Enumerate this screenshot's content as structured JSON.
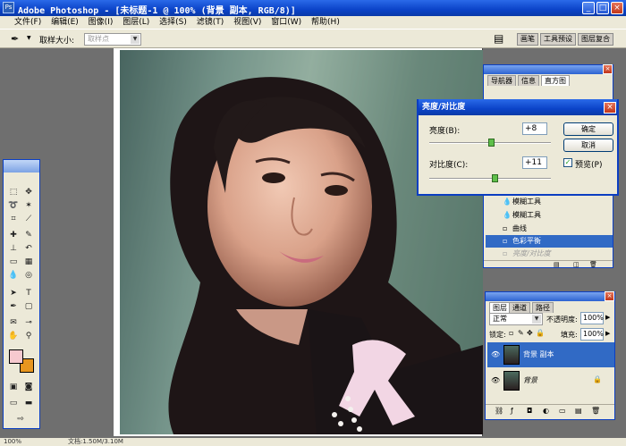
{
  "window": {
    "title": "Adobe Photoshop - [未标题-1 @ 100% (背景 副本, RGB/8)]"
  },
  "menu": [
    "文件(F)",
    "编辑(E)",
    "图像(I)",
    "图层(L)",
    "选择(S)",
    "滤镜(T)",
    "视图(V)",
    "窗口(W)",
    "帮助(H)"
  ],
  "options": {
    "sample_size_label": "取样大小:",
    "sample_size_value": "取样点"
  },
  "palette_well": [
    "画笔",
    "工具预设",
    "图层复合"
  ],
  "history": {
    "tabs": [
      "导航器",
      "信息",
      "直方图"
    ],
    "items": [
      {
        "label": "模糊工具",
        "state": "normal"
      },
      {
        "label": "模糊工具",
        "state": "normal"
      },
      {
        "label": "曲线",
        "state": "normal"
      },
      {
        "label": "色彩平衡",
        "state": "selected"
      },
      {
        "label": "亮度/对比度",
        "state": "dimmed"
      }
    ]
  },
  "dialog": {
    "title": "亮度/对比度",
    "brightness_label": "亮度(B):",
    "brightness_value": "+8",
    "contrast_label": "对比度(C):",
    "contrast_value": "+11",
    "ok": "确定",
    "cancel": "取消",
    "preview_label": "预览(P)",
    "preview_checked": true
  },
  "layers": {
    "tabs": [
      "图层",
      "通道",
      "路径"
    ],
    "blend_mode": "正常",
    "opacity_label": "不透明度:",
    "opacity": "100%",
    "lock_label": "锁定:",
    "fill_label": "填充:",
    "fill": "100%",
    "items": [
      {
        "name": "背景 副本",
        "selected": true
      },
      {
        "name": "背景",
        "selected": false,
        "italic": true
      }
    ]
  },
  "status": {
    "zoom": "100%",
    "doc": "文档:1.50M/3.10M"
  },
  "colors": {
    "foreground": "#f6c9cf",
    "background": "#e8961f"
  }
}
